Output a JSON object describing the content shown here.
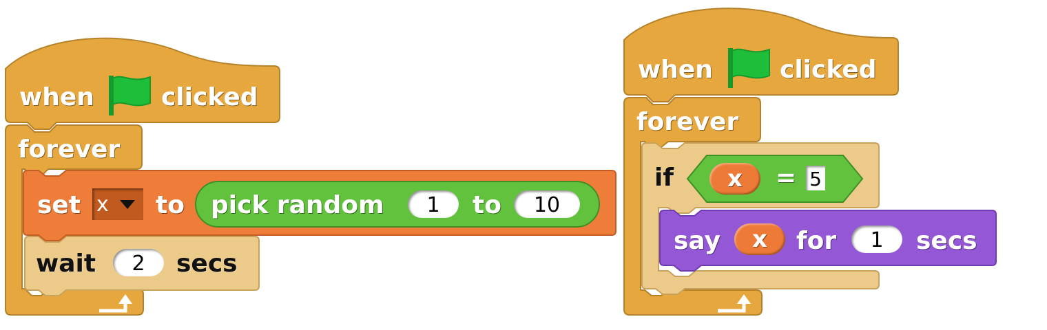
{
  "scripts": [
    {
      "hat": {
        "before": "when",
        "flag_icon": "green-flag-icon",
        "after": "clicked"
      },
      "loop": {
        "label": "forever",
        "loop_arrow_icon": "loop-arrow-icon"
      },
      "body": {
        "set_block": {
          "label": "set",
          "variable": "x",
          "to": "to"
        },
        "pick_random": {
          "label": "pick random",
          "from": "1",
          "to": "to",
          "to_value": "10"
        },
        "wait_block": {
          "label": "wait",
          "value": "2",
          "unit": "secs"
        }
      }
    },
    {
      "hat": {
        "before": "when",
        "flag_icon": "green-flag-icon",
        "after": "clicked"
      },
      "loop": {
        "label": "forever",
        "loop_arrow_icon": "loop-arrow-icon"
      },
      "body": {
        "if_block": {
          "label": "if"
        },
        "equals": {
          "left_var": "x",
          "operator": "=",
          "right_value": "5"
        },
        "say_block": {
          "label": "say",
          "var": "x",
          "for": "for",
          "value": "1",
          "unit": "secs"
        }
      }
    }
  ],
  "colors": {
    "control": "#e6a83e",
    "control_light": "#ecca8a",
    "variables": "#ee7d3a",
    "operators": "#62c23d",
    "looks": "#9457d6",
    "flag": "#1fbe3a"
  }
}
